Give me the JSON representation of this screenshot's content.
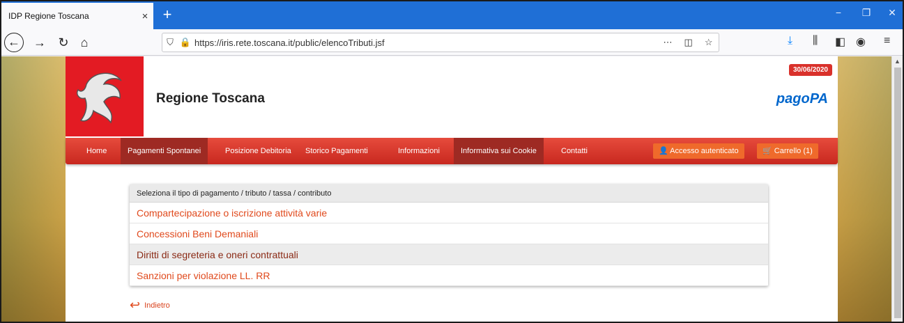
{
  "browser": {
    "tab_title": "IDP Regione Toscana",
    "tab_close": "×",
    "new_tab": "+",
    "url": "https://iris.rete.toscana.it/public/elencoTributi.jsf",
    "window_controls": {
      "minimize": "−",
      "restore": "❐",
      "close": "✕"
    }
  },
  "header": {
    "site_title": "Regione Toscana",
    "date": "30/06/2020",
    "pagopa": "pagoPA"
  },
  "menu": {
    "items": [
      {
        "label": "Home"
      },
      {
        "label": "Pagamenti Spontanei"
      },
      {
        "label": "Posizione Debitoria"
      },
      {
        "label": "Storico Pagamenti"
      },
      {
        "label": "Informazioni"
      },
      {
        "label": "Informativa sui Cookie"
      },
      {
        "label": "Contatti"
      }
    ],
    "login": "Accesso autenticato",
    "cart": "Carrello (1)"
  },
  "panel": {
    "heading": "Seleziona il tipo di pagamento / tributo / tassa / contributo",
    "rows": [
      "Compartecipazione o iscrizione attività varie",
      "Concessioni Beni Demaniali",
      "Diritti di segreteria e oneri contrattuali",
      "Sanzioni per violazione LL. RR"
    ]
  },
  "back_link": "Indietro",
  "colors": {
    "brand_red": "#e31b23",
    "link_orange": "#e0491c",
    "tab_blue": "#1f6fd6"
  }
}
